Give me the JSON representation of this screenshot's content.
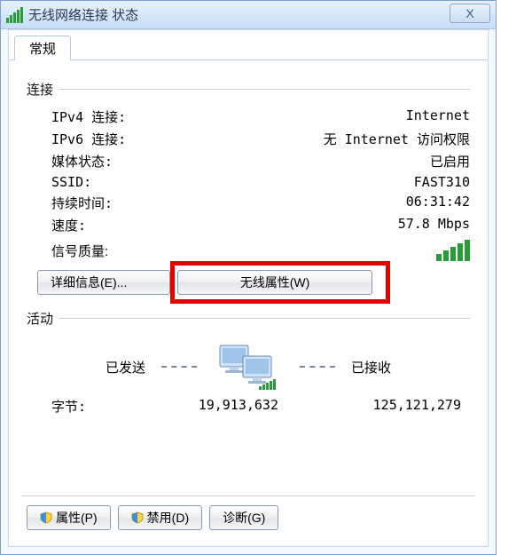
{
  "window": {
    "title": "无线网络连接 状态",
    "close_label": "X"
  },
  "tab": {
    "general": "常规"
  },
  "connection": {
    "legend": "连接",
    "ipv4_label": "IPv4 连接:",
    "ipv4_value": "Internet",
    "ipv6_label": "IPv6 连接:",
    "ipv6_value": "无 Internet 访问权限",
    "media_label": "媒体状态:",
    "media_value": "已启用",
    "ssid_label": "SSID:",
    "ssid_value": "FAST310",
    "duration_label": "持续时间:",
    "duration_value": "06:31:42",
    "speed_label": "速度:",
    "speed_value": "57.8 Mbps",
    "signal_label": "信号质量:",
    "details_btn": "详细信息(E)...",
    "wireless_props_btn": "无线属性(W)"
  },
  "activity": {
    "legend": "活动",
    "sent_label": "已发送",
    "recv_label": "已接收",
    "bytes_label": "字节:",
    "sent_value": "19,913,632",
    "recv_value": "125,121,279"
  },
  "bottom": {
    "properties": "属性(P)",
    "disable": "禁用(D)",
    "diagnose": "诊断(G)"
  }
}
